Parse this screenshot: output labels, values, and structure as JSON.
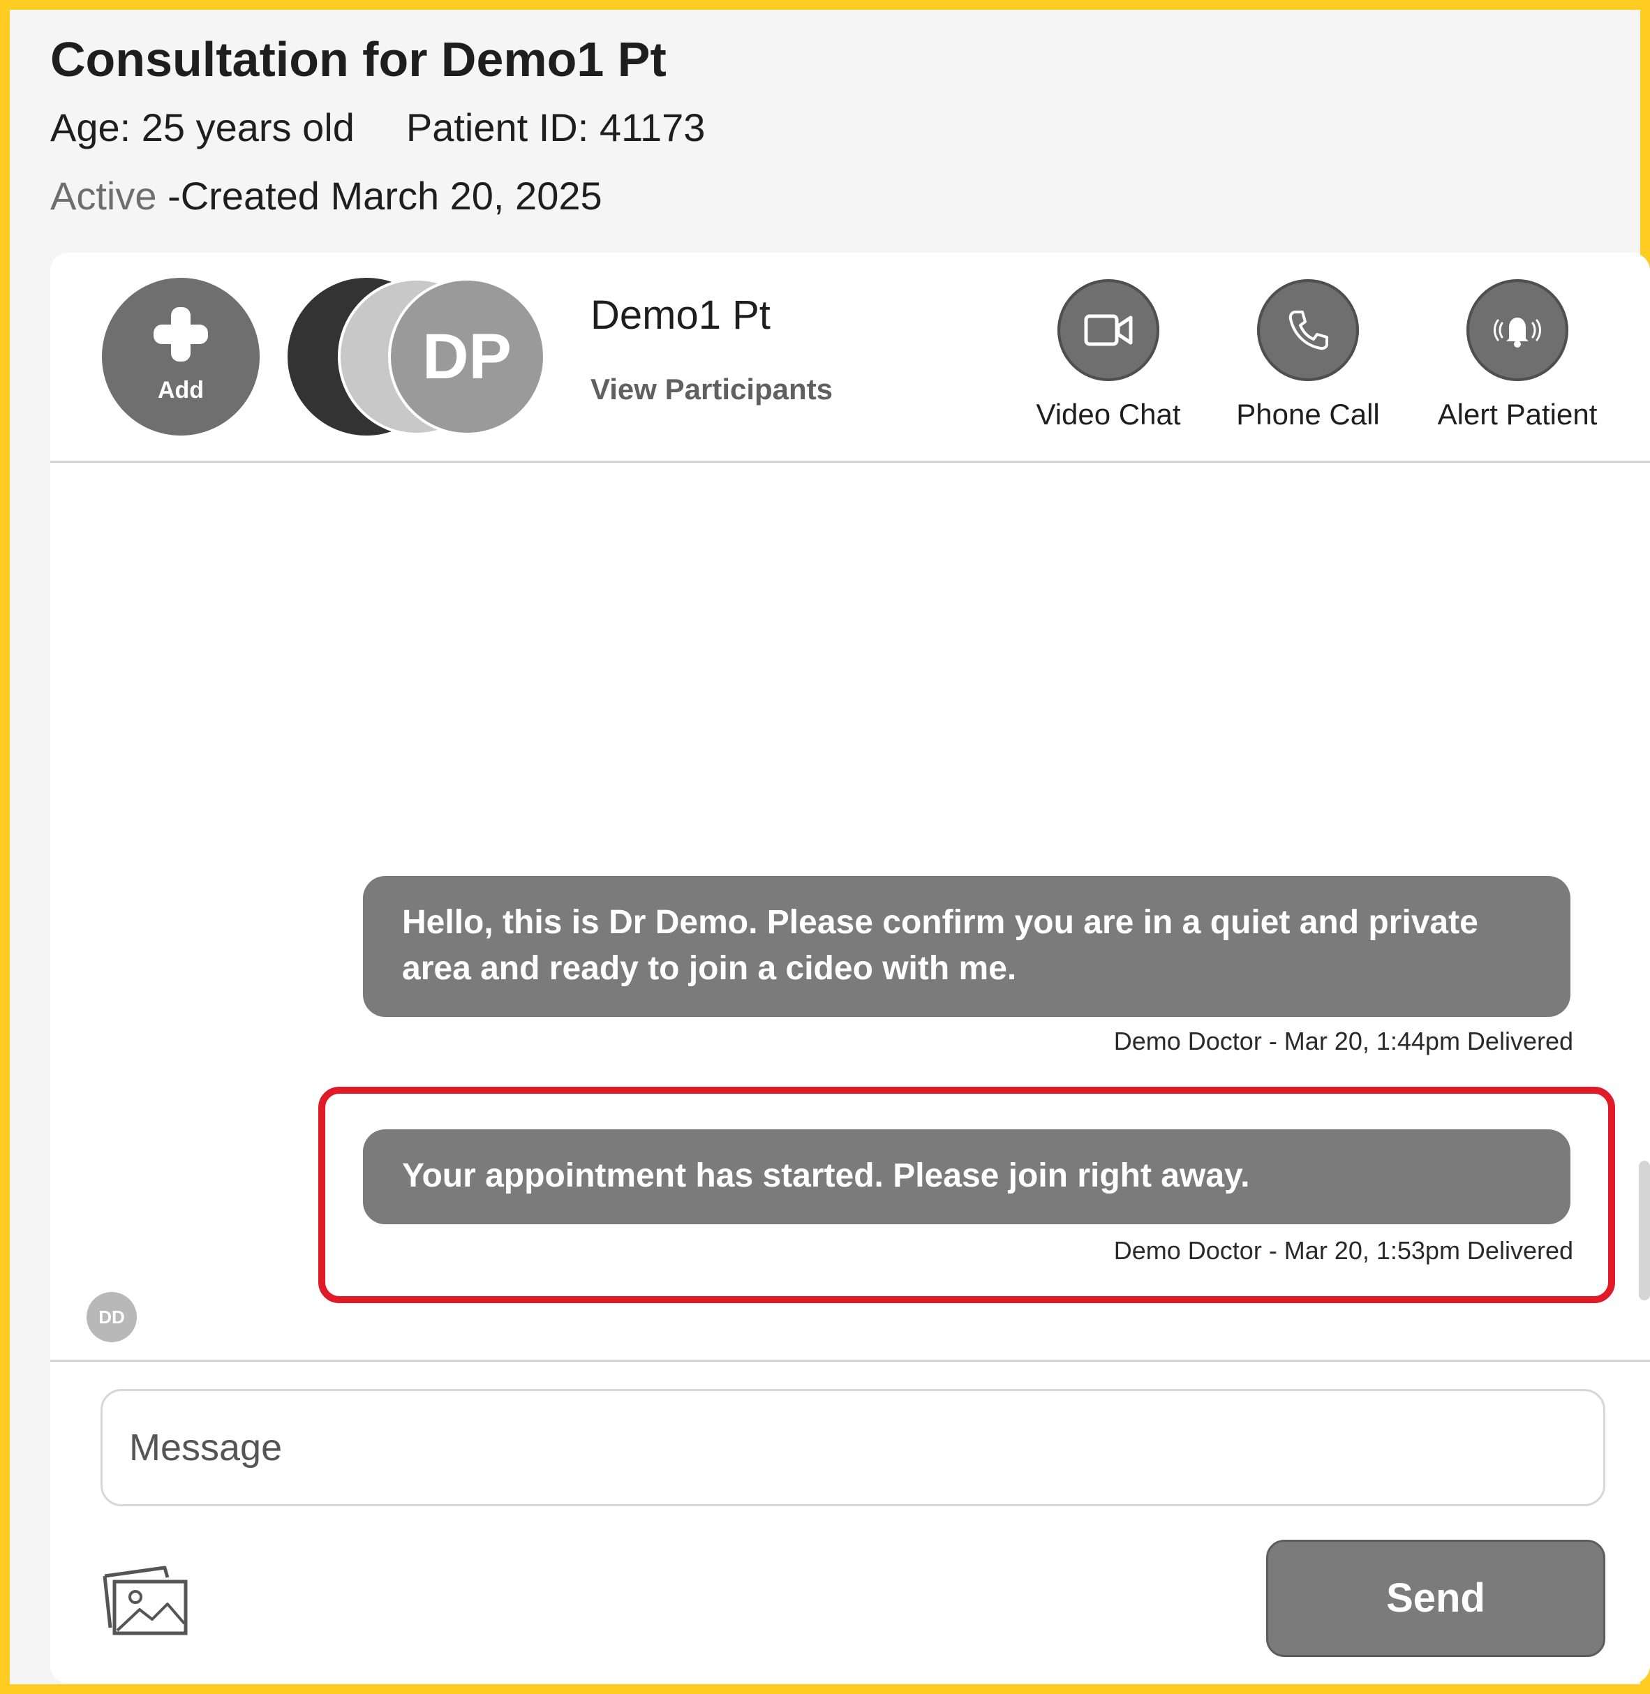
{
  "header": {
    "title": "Consultation for Demo1 Pt",
    "age": "Age: 25 years old",
    "patient_id": "Patient ID: 41173",
    "status": "Active",
    "created": "-Created March 20, 2025"
  },
  "conversation": {
    "add_label": "Add",
    "avatar_initials": "DP",
    "participant_name": "Demo1 Pt",
    "view_participants": "View Participants",
    "actions": {
      "video": "Video Chat",
      "phone": "Phone Call",
      "alert": "Alert Patient"
    }
  },
  "messages": [
    {
      "text": "Hello, this is Dr Demo.  Please confirm you are in a quiet and private area and ready to join a cideo with me.",
      "meta": "Demo Doctor - Mar 20, 1:44pm Delivered"
    },
    {
      "text": "Your appointment has started. Please join right away.",
      "meta": "Demo Doctor - Mar 20, 1:53pm Delivered"
    }
  ],
  "sender_initials": "DD",
  "composer": {
    "placeholder": "Message",
    "send_label": "Send"
  },
  "colors": {
    "frame_border": "#ffcc22",
    "bubble": "#7b7b7b",
    "highlight": "#e01a26"
  }
}
